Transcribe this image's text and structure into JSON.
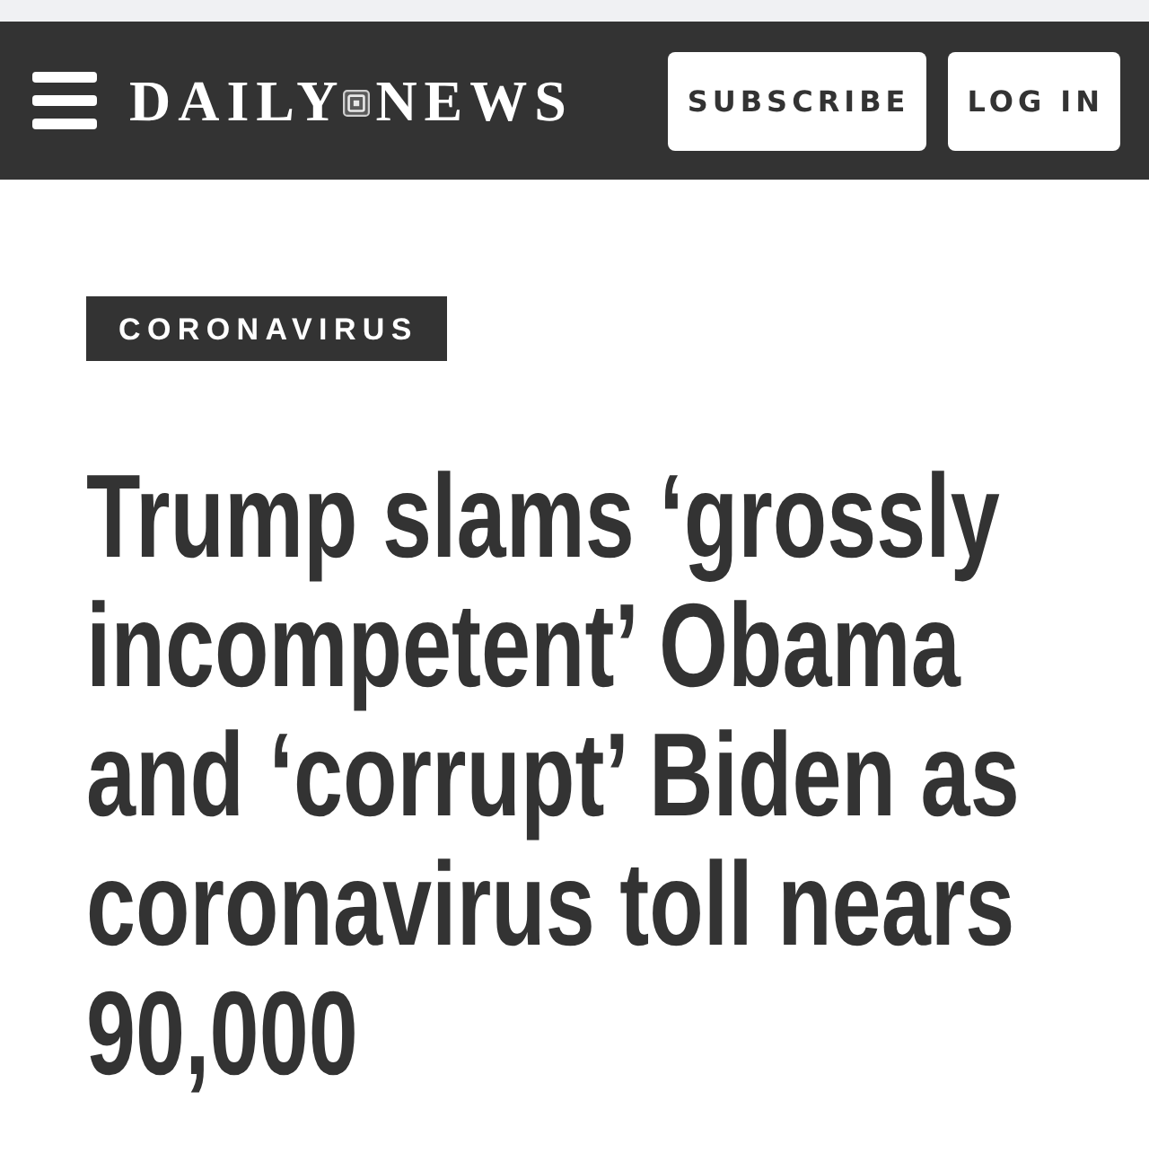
{
  "header": {
    "logo": {
      "left": "DAILY",
      "right": "NEWS"
    },
    "buttons": [
      {
        "label": "SUBSCRIBE"
      },
      {
        "label": "LOG IN"
      }
    ]
  },
  "article": {
    "section_tag": "CORONAVIRUS",
    "headline": "Trump slams ‘grossly incompetent’ Obama and ‘corrupt’ Biden as coronavirus toll nears 90,000"
  }
}
